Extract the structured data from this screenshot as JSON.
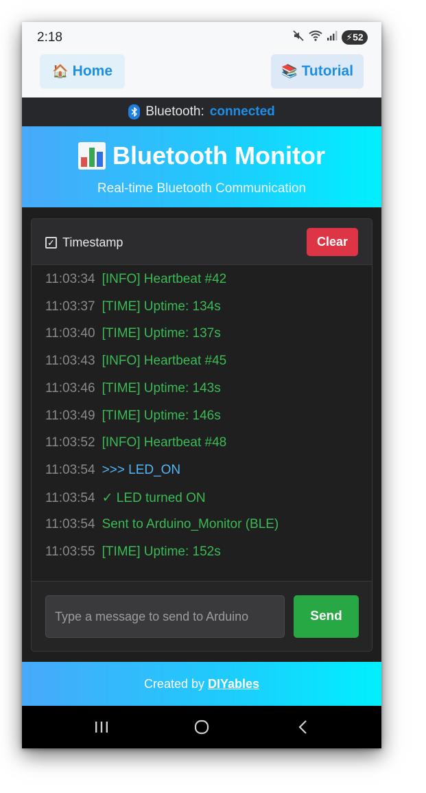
{
  "status_bar": {
    "time": "2:18",
    "battery_level": "52",
    "icons": [
      "mute-icon",
      "wifi-icon",
      "signal-icon",
      "battery-icon"
    ]
  },
  "nav": {
    "home": {
      "emoji": "🏠",
      "label": "Home"
    },
    "tutorial": {
      "emoji": "📚",
      "label": "Tutorial"
    }
  },
  "bluetooth": {
    "label": "Bluetooth:",
    "state": "connected",
    "state_color": "#1e8fe8"
  },
  "header": {
    "title": "Bluetooth Monitor",
    "subtitle": "Real-time Bluetooth Communication",
    "icon": "bar-chart-icon"
  },
  "monitor": {
    "timestamp_toggle": {
      "label": "Timestamp",
      "checked": true,
      "glyph": "✓"
    },
    "clear_label": "Clear",
    "log": [
      {
        "ts": "11:03:34",
        "msg": "[INFO] Heartbeat #42",
        "kind": "info"
      },
      {
        "ts": "11:03:37",
        "msg": "[TIME] Uptime: 134s",
        "kind": "info"
      },
      {
        "ts": "11:03:40",
        "msg": "[TIME] Uptime: 137s",
        "kind": "info"
      },
      {
        "ts": "11:03:43",
        "msg": "[INFO] Heartbeat #45",
        "kind": "info"
      },
      {
        "ts": "11:03:46",
        "msg": "[TIME] Uptime: 143s",
        "kind": "info"
      },
      {
        "ts": "11:03:49",
        "msg": "[TIME] Uptime: 146s",
        "kind": "info"
      },
      {
        "ts": "11:03:52",
        "msg": "[INFO] Heartbeat #48",
        "kind": "info"
      },
      {
        "ts": "11:03:54",
        "msg": ">>> LED_ON",
        "kind": "sent"
      },
      {
        "ts": "11:03:54",
        "msg": "✓ LED turned ON",
        "kind": "info"
      },
      {
        "ts": "11:03:54",
        "msg": "Sent to Arduino_Monitor (BLE)",
        "kind": "info"
      },
      {
        "ts": "11:03:55",
        "msg": "[TIME] Uptime: 152s",
        "kind": "info"
      }
    ],
    "input": {
      "value": "",
      "placeholder": "Type a message to send to Arduino"
    },
    "send_label": "Send"
  },
  "footer": {
    "prefix": "Created by",
    "link_label": "DIYables"
  },
  "colors": {
    "gradient_start": "#48a9fb",
    "gradient_end": "#00f0ff",
    "nav_link": "#1e8fe0",
    "clear": "#dd3545",
    "send": "#28a745",
    "log_info": "#3bba56",
    "log_sent": "#52b7f4",
    "log_timestamp": "#8a8a8a"
  }
}
